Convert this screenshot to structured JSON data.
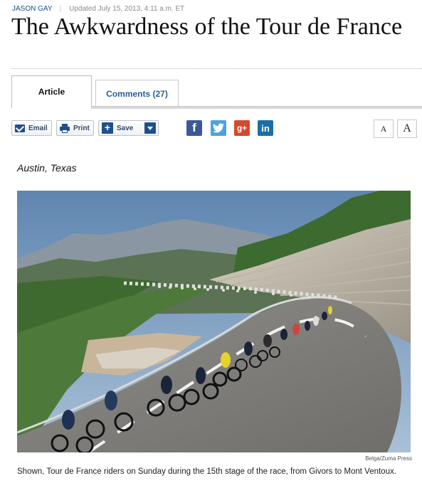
{
  "byline": {
    "author": "JASON GAY",
    "separator": "|",
    "updated": "Updated July 15, 2013, 4:11 a.m. ET"
  },
  "headline": "The Awkwardness of the Tour de France",
  "tabs": [
    {
      "label": "Article",
      "active": true
    },
    {
      "label": "Comments (27)",
      "active": false
    }
  ],
  "toolbar": {
    "email_label": "Email",
    "print_label": "Print",
    "save_label": "Save"
  },
  "social": [
    {
      "name": "facebook",
      "glyph": "f",
      "color": "#3b5998"
    },
    {
      "name": "twitter",
      "glyph": "twitter-bird",
      "color": "#4aa3df"
    },
    {
      "name": "google-plus",
      "glyph": "g+",
      "color": "#d3492c"
    },
    {
      "name": "linkedin",
      "glyph": "in",
      "color": "#1a6fa8"
    }
  ],
  "font_size_buttons": {
    "small": "A",
    "large": "A"
  },
  "dateline": "Austin, Texas",
  "photo": {
    "credit": "Belga/Zuma Press",
    "caption": "Shown, Tour de France riders on Sunday during the 15th stage of the race, from Givors to Mont Ventoux."
  },
  "colors": {
    "link_blue": "#2a5d99",
    "button_blue": "#1f4f8e"
  }
}
